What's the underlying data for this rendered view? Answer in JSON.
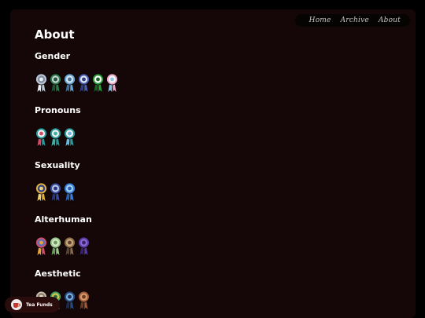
{
  "nav": {
    "items": [
      {
        "label": "Home"
      },
      {
        "label": "Archive"
      },
      {
        "label": "About"
      }
    ]
  },
  "page": {
    "title": "About"
  },
  "sections": [
    {
      "heading": "Gender",
      "badges": [
        {
          "icon": "ribbon-badge-icon",
          "colors": [
            "#bfc7d6",
            "#7f8c9e",
            "#e7ecf2"
          ]
        },
        {
          "icon": "ribbon-badge-icon",
          "colors": [
            "#2f7d4d",
            "#c9d1d9",
            "#1f5134"
          ]
        },
        {
          "icon": "ribbon-badge-icon",
          "colors": [
            "#6aa7d6",
            "#d7e3ee",
            "#3f6f97"
          ]
        },
        {
          "icon": "ribbon-badge-icon",
          "colors": [
            "#4a5fb0",
            "#e4e7f3",
            "#2d3d80"
          ]
        },
        {
          "icon": "ribbon-badge-icon",
          "colors": [
            "#2e9c3a",
            "#ffffff",
            "#1a6323"
          ]
        },
        {
          "icon": "ribbon-badge-icon",
          "colors": [
            "#e9a8c8",
            "#f7f7f7",
            "#8fc4e6"
          ]
        }
      ]
    },
    {
      "heading": "Pronouns",
      "badges": [
        {
          "icon": "ribbon-badge-icon",
          "colors": [
            "#2c9a9a",
            "#f2f2f2",
            "#d24b6a"
          ]
        },
        {
          "icon": "ribbon-badge-icon",
          "colors": [
            "#2c9a9a",
            "#f2f2f2",
            "#3fb1a2"
          ]
        },
        {
          "icon": "ribbon-badge-icon",
          "colors": [
            "#2c9a9a",
            "#f2f2f2",
            "#6ab7e0"
          ]
        }
      ]
    },
    {
      "heading": "Sexuality",
      "badges": [
        {
          "icon": "ribbon-badge-icon",
          "colors": [
            "#e0b040",
            "#2c3f8c",
            "#f0d070"
          ]
        },
        {
          "icon": "ribbon-badge-icon",
          "colors": [
            "#3b4a9c",
            "#b8c7e8",
            "#2b347a"
          ]
        },
        {
          "icon": "ribbon-badge-icon",
          "colors": [
            "#3d7fd6",
            "#9fd0f2",
            "#2a5fb0"
          ]
        }
      ]
    },
    {
      "heading": "Alterhuman",
      "badges": [
        {
          "icon": "ribbon-badge-icon",
          "colors": [
            "#d0506a",
            "#5a6fc0",
            "#e8a23a"
          ]
        },
        {
          "icon": "ribbon-badge-icon",
          "colors": [
            "#9cc48a",
            "#d6e8c8",
            "#6a9a5a"
          ]
        },
        {
          "icon": "ribbon-badge-icon",
          "colors": [
            "#8a6a4a",
            "#c8a87a",
            "#5a4030"
          ]
        },
        {
          "icon": "ribbon-badge-icon",
          "colors": [
            "#5a3aa0",
            "#8a6ad0",
            "#3a2270"
          ]
        }
      ]
    },
    {
      "heading": "Aesthetic",
      "badges": [
        {
          "icon": "ribbon-badge-icon",
          "colors": [
            "#c8b8a8",
            "#8a7a6a",
            "#e8dcd0"
          ]
        },
        {
          "icon": "ribbon-badge-icon",
          "colors": [
            "#4aa06a",
            "#d8c84a",
            "#2a6a42"
          ]
        },
        {
          "icon": "ribbon-badge-icon",
          "colors": [
            "#2a4a7a",
            "#7ab0e0",
            "#1a2a50"
          ]
        },
        {
          "icon": "ribbon-badge-icon",
          "colors": [
            "#a05a3a",
            "#d89a6a",
            "#6a3a22"
          ]
        }
      ]
    }
  ],
  "footer": {
    "tea_label": "Tea Funds",
    "tea_icon": "teacup-icon"
  }
}
